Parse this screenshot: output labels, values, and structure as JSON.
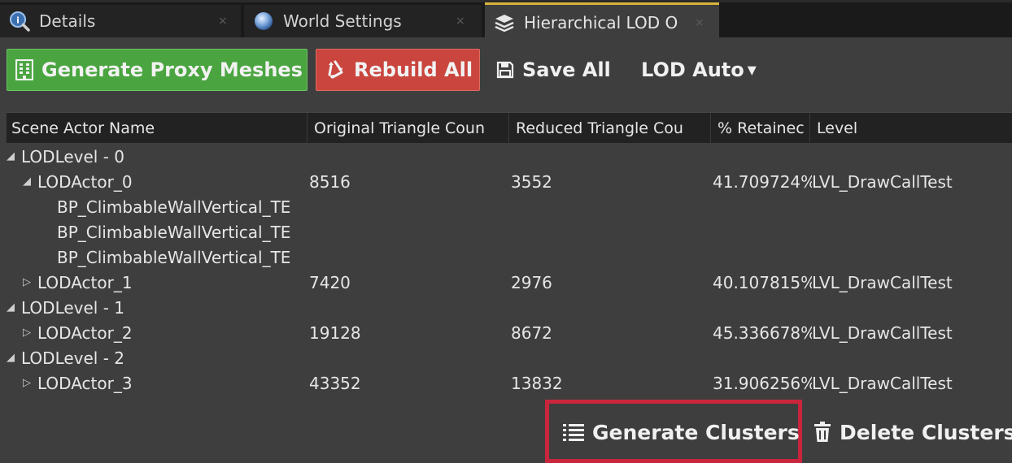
{
  "tabs": [
    {
      "label": "Details",
      "icon": "details-magnifier-icon",
      "close": "×"
    },
    {
      "label": "World Settings",
      "icon": "globe-icon",
      "close": "×"
    },
    {
      "label": "Hierarchical LOD O",
      "icon": "layers-icon",
      "close": "×",
      "active": true
    }
  ],
  "toolbar": {
    "generate_proxy_label": "Generate Proxy Meshes",
    "rebuild_all_label": "Rebuild All",
    "save_all_label": "Save All",
    "lod_label": "LOD Auto",
    "lod_arrow": "▾"
  },
  "table": {
    "headers": [
      "Scene Actor Name",
      "Original Triangle Coun",
      "Reduced Triangle Cou",
      "% Retainec",
      "Level"
    ],
    "rows": [
      {
        "toggle": "◢",
        "name": "LODLevel - 0",
        "orig": "",
        "red": "",
        "ret": "",
        "level": ""
      },
      {
        "toggle": "◢",
        "name": "LODActor_0",
        "orig": "8516",
        "red": "3552",
        "ret": "41.709724%",
        "level": "LVL_DrawCallTest"
      },
      {
        "toggle": "",
        "name": "BP_ClimbableWallVertical_TE",
        "orig": "",
        "red": "",
        "ret": "",
        "level": ""
      },
      {
        "toggle": "",
        "name": "BP_ClimbableWallVertical_TE",
        "orig": "",
        "red": "",
        "ret": "",
        "level": ""
      },
      {
        "toggle": "",
        "name": "BP_ClimbableWallVertical_TE",
        "orig": "",
        "red": "",
        "ret": "",
        "level": ""
      },
      {
        "toggle": "▷",
        "name": "LODActor_1",
        "orig": "7420",
        "red": "2976",
        "ret": "40.107815%",
        "level": "LVL_DrawCallTest"
      },
      {
        "toggle": "◢",
        "name": "LODLevel - 1",
        "orig": "",
        "red": "",
        "ret": "",
        "level": ""
      },
      {
        "toggle": "▷",
        "name": "LODActor_2",
        "orig": "19128",
        "red": "8672",
        "ret": "45.336678%",
        "level": "LVL_DrawCallTest"
      },
      {
        "toggle": "◢",
        "name": "LODLevel - 2",
        "orig": "",
        "red": "",
        "ret": "",
        "level": ""
      },
      {
        "toggle": "▷",
        "name": "LODActor_3",
        "orig": "43352",
        "red": "13832",
        "ret": "31.906256%",
        "level": "LVL_DrawCallTest"
      }
    ]
  },
  "bottom": {
    "generate_clusters_label": "Generate Clusters",
    "delete_clusters_label": "Delete Clusters"
  },
  "colors": {
    "generate_button": "#4aa540",
    "rebuild_button": "#c9453e",
    "highlight": "#c9253d",
    "active_tab_accent": "#d9b43a"
  }
}
